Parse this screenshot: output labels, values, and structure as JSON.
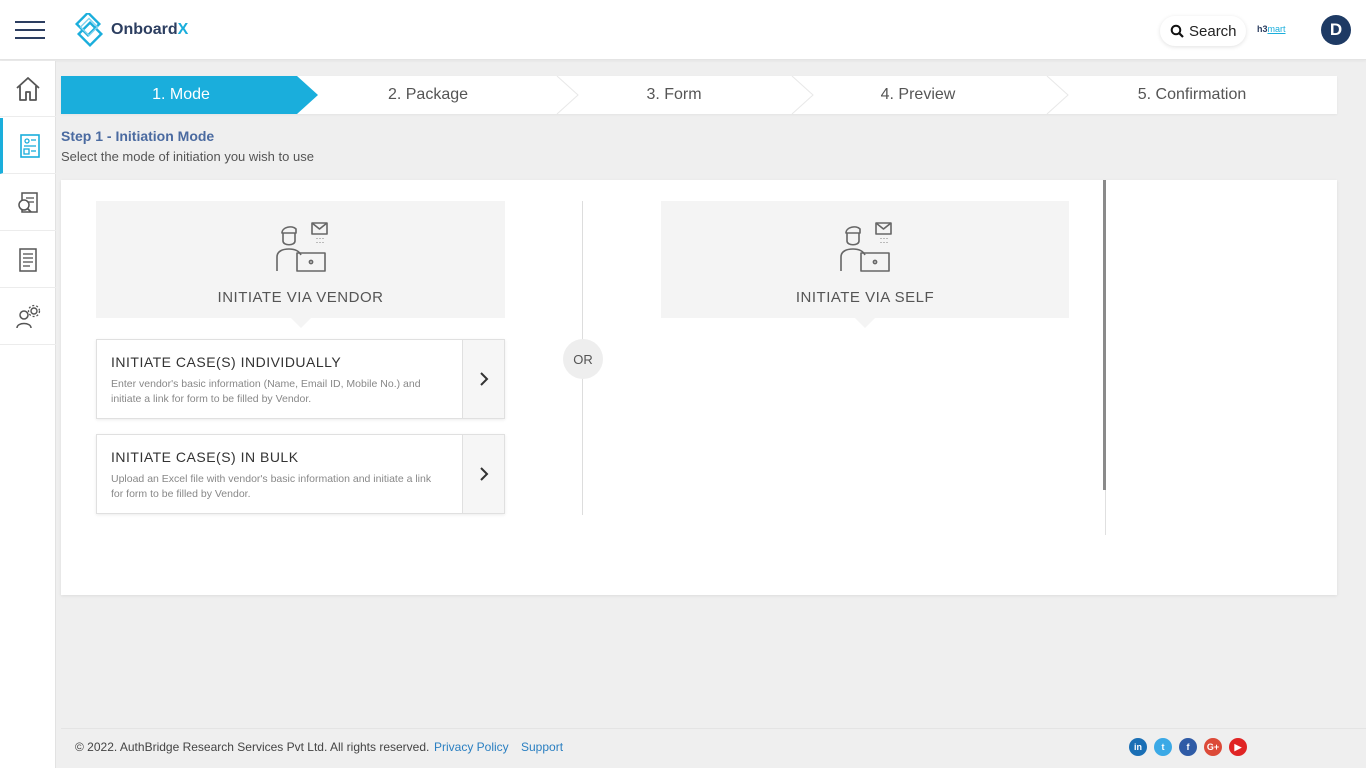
{
  "header": {
    "brand_name": "Onboard",
    "brand_suffix": "X",
    "search_label": "Search",
    "partner_prefix": "h3",
    "partner_suffix": "mart",
    "avatar_initial": "D"
  },
  "sidebar": {
    "items": [
      {
        "icon": "home-icon"
      },
      {
        "icon": "case-form-icon",
        "active": true
      },
      {
        "icon": "search-report-icon"
      },
      {
        "icon": "document-icon"
      },
      {
        "icon": "user-settings-icon"
      }
    ]
  },
  "stepper": {
    "steps": [
      {
        "label": "1. Mode",
        "active": true
      },
      {
        "label": "2. Package"
      },
      {
        "label": "3. Form"
      },
      {
        "label": "4. Preview"
      },
      {
        "label": "5. Confirmation"
      }
    ],
    "active_color": "#1aaedc"
  },
  "step_heading": {
    "title": "Step 1 - Initiation Mode",
    "subtitle": "Select the mode of initiation you wish to use"
  },
  "modes": {
    "vendor": {
      "label": "INITIATE VIA VENDOR",
      "icon": "person-laptop-mail-icon",
      "options": [
        {
          "title": "INITIATE CASE(S) INDIVIDUALLY",
          "description": "Enter vendor's basic information (Name, Email ID, Mobile No.) and initiate a link for form to be filled by Vendor."
        },
        {
          "title": "INITIATE CASE(S) IN BULK",
          "description": "Upload an Excel file with vendor's basic information and initiate a link for form to be filled by Vendor."
        }
      ]
    },
    "or_label": "OR",
    "self": {
      "label": "INITIATE VIA SELF",
      "icon": "person-laptop-mail-icon"
    }
  },
  "footer": {
    "copyright": "© 2022. AuthBridge Research Services Pvt Ltd. All rights reserved.",
    "privacy_label": "Privacy Policy",
    "support_label": "Support",
    "social": [
      {
        "icon": "linkedin-icon",
        "text": "in",
        "color": "#1a6fb5"
      },
      {
        "icon": "twitter-icon",
        "text": "t",
        "color": "#3ba9e6"
      },
      {
        "icon": "facebook-icon",
        "text": "f",
        "color": "#2f5ba6"
      },
      {
        "icon": "google-plus-icon",
        "text": "G+",
        "color": "#dc4a38"
      },
      {
        "icon": "youtube-icon",
        "text": "▶",
        "color": "#e02424"
      }
    ]
  }
}
